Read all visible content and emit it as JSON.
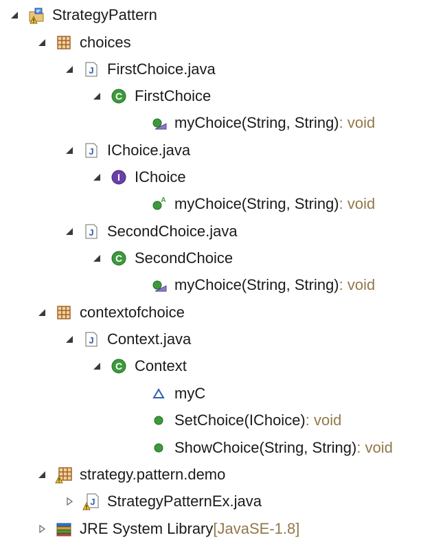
{
  "tree": {
    "project": {
      "label": "StrategyPattern",
      "icon": "java-project-icon"
    },
    "pkg_choices": {
      "label": "choices",
      "icon": "package-icon"
    },
    "file_first": {
      "label": "FirstChoice.java",
      "icon": "java-file-icon"
    },
    "class_first": {
      "label": "FirstChoice",
      "icon": "class-icon"
    },
    "method_first": {
      "label": "myChoice(String, String)",
      "suffix": " : void",
      "icon": "override-method-icon"
    },
    "file_ichoice": {
      "label": "IChoice.java",
      "icon": "java-file-icon"
    },
    "iface_ichoice": {
      "label": "IChoice",
      "icon": "interface-icon"
    },
    "method_ichoice": {
      "label": "myChoice(String, String)",
      "suffix": " : void",
      "icon": "abstract-method-icon"
    },
    "file_second": {
      "label": "SecondChoice.java",
      "icon": "java-file-icon"
    },
    "class_second": {
      "label": "SecondChoice",
      "icon": "class-icon"
    },
    "method_second": {
      "label": "myChoice(String, String)",
      "suffix": " : void",
      "icon": "override-method-icon"
    },
    "pkg_context": {
      "label": "contextofchoice",
      "icon": "package-icon"
    },
    "file_context": {
      "label": "Context.java",
      "icon": "java-file-icon"
    },
    "class_context": {
      "label": "Context",
      "icon": "class-icon"
    },
    "field_myc": {
      "label": "myC",
      "icon": "package-field-icon"
    },
    "method_setchoice": {
      "label": "SetChoice(IChoice)",
      "suffix": " : void",
      "icon": "public-method-icon"
    },
    "method_showchoice": {
      "label": "ShowChoice(String, String)",
      "suffix": " : void",
      "icon": "public-method-icon"
    },
    "pkg_demo": {
      "label": "strategy.pattern.demo",
      "icon": "package-warning-icon"
    },
    "file_demo": {
      "label": "StrategyPatternEx.java",
      "icon": "java-file-warning-icon"
    },
    "jre": {
      "label": "JRE System Library",
      "suffix": " [JavaSE-1.8]",
      "icon": "library-icon"
    }
  },
  "colors": {
    "tree_arrow": "#3a3a3a",
    "class_green": "#3c9a3c",
    "interface_purple": "#6a3fa8",
    "package_brown": "#a0622d",
    "java_file_blue": "#2f5fb3",
    "type_suffix": "#93784a",
    "warning_yellow": "#f2c22c"
  }
}
